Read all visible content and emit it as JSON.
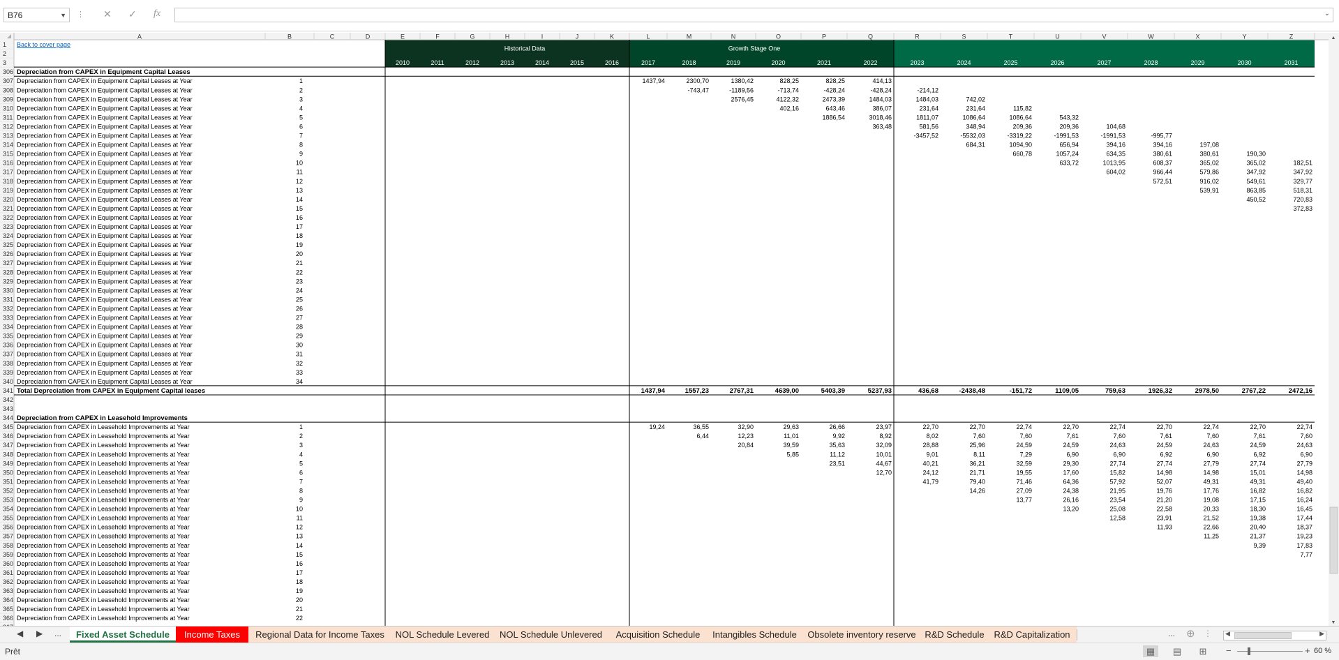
{
  "formula_bar": {
    "name_box": "B76",
    "formula": "",
    "cancel_icon": "✕",
    "enter_icon": "✓",
    "fx_icon": "fx"
  },
  "sheet": {
    "col_headers": [
      "A",
      "B",
      "C",
      "D",
      "E",
      "F",
      "G",
      "H",
      "I",
      "J",
      "K",
      "L",
      "M",
      "N",
      "O",
      "P",
      "Q",
      "R",
      "S",
      "T",
      "U",
      "V",
      "W",
      "X",
      "Y",
      "Z"
    ],
    "back_link": "Back to cover page",
    "group_labels": {
      "historical": "Historical Data",
      "growth": "Growth Stage One"
    },
    "years": [
      "2010",
      "2011",
      "2012",
      "2013",
      "2014",
      "2015",
      "2016",
      "2017",
      "2018",
      "2019",
      "2020",
      "2021",
      "2022",
      "2023",
      "2024",
      "2025",
      "2026",
      "2027",
      "2028",
      "2029",
      "2030",
      "2031"
    ],
    "sections": [
      {
        "header_row": 306,
        "title": "Depreciation from CAPEX in Equipment Capital Leases",
        "label": "Depreciation from CAPEX in Equipment Capital Leases at Year",
        "rows": [
          {
            "r": 307,
            "b": "1",
            "v": {
              "L": "1437,94",
              "M": "2300,70",
              "N": "1380,42",
              "O": "828,25",
              "P": "828,25",
              "Q": "414,13"
            }
          },
          {
            "r": 308,
            "b": "2",
            "v": {
              "M": "-743,47",
              "N": "-1189,56",
              "O": "-713,74",
              "P": "-428,24",
              "Q": "-428,24",
              "R": "-214,12"
            }
          },
          {
            "r": 309,
            "b": "3",
            "v": {
              "N": "2576,45",
              "O": "4122,32",
              "P": "2473,39",
              "Q": "1484,03",
              "R": "1484,03",
              "S": "742,02"
            }
          },
          {
            "r": 310,
            "b": "4",
            "v": {
              "O": "402,16",
              "P": "643,46",
              "Q": "386,07",
              "R": "231,64",
              "S": "231,64",
              "T": "115,82"
            }
          },
          {
            "r": 311,
            "b": "5",
            "v": {
              "P": "1886,54",
              "Q": "3018,46",
              "R": "1811,07",
              "S": "1086,64",
              "T": "1086,64",
              "U": "543,32"
            }
          },
          {
            "r": 312,
            "b": "6",
            "v": {
              "Q": "363,48",
              "R": "581,56",
              "S": "348,94",
              "T": "209,36",
              "U": "209,36",
              "V": "104,68"
            }
          },
          {
            "r": 313,
            "b": "7",
            "v": {
              "R": "-3457,52",
              "S": "-5532,03",
              "T": "-3319,22",
              "U": "-1991,53",
              "V": "-1991,53",
              "W": "-995,77"
            }
          },
          {
            "r": 314,
            "b": "8",
            "v": {
              "S": "684,31",
              "T": "1094,90",
              "U": "656,94",
              "V": "394,16",
              "W": "394,16",
              "X": "197,08"
            }
          },
          {
            "r": 315,
            "b": "9",
            "v": {
              "T": "660,78",
              "U": "1057,24",
              "V": "634,35",
              "W": "380,61",
              "X": "380,61",
              "Y": "190,30"
            }
          },
          {
            "r": 316,
            "b": "10",
            "v": {
              "U": "633,72",
              "V": "1013,95",
              "W": "608,37",
              "X": "365,02",
              "Y": "365,02",
              "Z": "182,51"
            }
          },
          {
            "r": 317,
            "b": "11",
            "v": {
              "V": "604,02",
              "W": "966,44",
              "X": "579,86",
              "Y": "347,92",
              "Z": "347,92"
            }
          },
          {
            "r": 318,
            "b": "12",
            "v": {
              "W": "572,51",
              "X": "916,02",
              "Y": "549,61",
              "Z": "329,77"
            }
          },
          {
            "r": 319,
            "b": "13",
            "v": {
              "X": "539,91",
              "Y": "863,85",
              "Z": "518,31"
            }
          },
          {
            "r": 320,
            "b": "14",
            "v": {
              "Y": "450,52",
              "Z": "720,83"
            }
          },
          {
            "r": 321,
            "b": "15",
            "v": {
              "Z": "372,83"
            }
          },
          {
            "r": 322,
            "b": "16",
            "v": {}
          },
          {
            "r": 323,
            "b": "17",
            "v": {}
          },
          {
            "r": 324,
            "b": "18",
            "v": {}
          },
          {
            "r": 325,
            "b": "19",
            "v": {}
          },
          {
            "r": 326,
            "b": "20",
            "v": {}
          },
          {
            "r": 327,
            "b": "21",
            "v": {}
          },
          {
            "r": 328,
            "b": "22",
            "v": {}
          },
          {
            "r": 329,
            "b": "23",
            "v": {}
          },
          {
            "r": 330,
            "b": "24",
            "v": {}
          },
          {
            "r": 331,
            "b": "25",
            "v": {}
          },
          {
            "r": 332,
            "b": "26",
            "v": {}
          },
          {
            "r": 333,
            "b": "27",
            "v": {}
          },
          {
            "r": 334,
            "b": "28",
            "v": {}
          },
          {
            "r": 335,
            "b": "29",
            "v": {}
          },
          {
            "r": 336,
            "b": "30",
            "v": {}
          },
          {
            "r": 337,
            "b": "31",
            "v": {}
          },
          {
            "r": 338,
            "b": "32",
            "v": {}
          },
          {
            "r": 339,
            "b": "33",
            "v": {}
          },
          {
            "r": 340,
            "b": "34",
            "v": {}
          }
        ],
        "total": {
          "r": 341,
          "label": "Total Depreciation from CAPEX in Equipment Capital leases",
          "v": {
            "L": "1437,94",
            "M": "1557,23",
            "N": "2767,31",
            "O": "4639,00",
            "P": "5403,39",
            "Q": "5237,93",
            "R": "436,68",
            "S": "-2438,48",
            "T": "-151,72",
            "U": "1109,05",
            "V": "759,63",
            "W": "1926,32",
            "X": "2978,50",
            "Y": "2767,22",
            "Z": "2472,16"
          }
        }
      },
      {
        "header_row": 344,
        "title": "Depreciation from CAPEX in Leasehold Improvements",
        "label": "Depreciation from CAPEX in Leasehold Improvements at Year",
        "rows": [
          {
            "r": 345,
            "b": "1",
            "v": {
              "L": "19,24",
              "M": "36,55",
              "N": "32,90",
              "O": "29,63",
              "P": "26,66",
              "Q": "23,97",
              "R": "22,70",
              "S": "22,70",
              "T": "22,74",
              "U": "22,70",
              "V": "22,74",
              "W": "22,70",
              "X": "22,74",
              "Y": "22,70",
              "Z": "22,74"
            }
          },
          {
            "r": 346,
            "b": "2",
            "v": {
              "M": "6,44",
              "N": "12,23",
              "O": "11,01",
              "P": "9,92",
              "Q": "8,92",
              "R": "8,02",
              "S": "7,60",
              "T": "7,60",
              "U": "7,61",
              "V": "7,60",
              "W": "7,61",
              "X": "7,60",
              "Y": "7,61",
              "Z": "7,60"
            }
          },
          {
            "r": 347,
            "b": "3",
            "v": {
              "N": "20,84",
              "O": "39,59",
              "P": "35,63",
              "Q": "32,09",
              "R": "28,88",
              "S": "25,96",
              "T": "24,59",
              "U": "24,59",
              "V": "24,63",
              "W": "24,59",
              "X": "24,63",
              "Y": "24,59",
              "Z": "24,63"
            }
          },
          {
            "r": 348,
            "b": "4",
            "v": {
              "O": "5,85",
              "P": "11,12",
              "Q": "10,01",
              "R": "9,01",
              "S": "8,11",
              "T": "7,29",
              "U": "6,90",
              "V": "6,90",
              "W": "6,92",
              "X": "6,90",
              "Y": "6,92",
              "Z": "6,90"
            }
          },
          {
            "r": 349,
            "b": "5",
            "v": {
              "P": "23,51",
              "Q": "44,67",
              "R": "40,21",
              "S": "36,21",
              "T": "32,59",
              "U": "29,30",
              "V": "27,74",
              "W": "27,74",
              "X": "27,79",
              "Y": "27,74",
              "Z": "27,79"
            }
          },
          {
            "r": 350,
            "b": "6",
            "v": {
              "Q": "12,70",
              "R": "24,12",
              "S": "21,71",
              "T": "19,55",
              "U": "17,60",
              "V": "15,82",
              "W": "14,98",
              "X": "14,98",
              "Y": "15,01",
              "Z": "14,98"
            }
          },
          {
            "r": 351,
            "b": "7",
            "v": {
              "R": "41,79",
              "S": "79,40",
              "T": "71,46",
              "U": "64,36",
              "V": "57,92",
              "W": "52,07",
              "X": "49,31",
              "Y": "49,31",
              "Z": "49,40"
            }
          },
          {
            "r": 352,
            "b": "8",
            "v": {
              "S": "14,26",
              "T": "27,09",
              "U": "24,38",
              "V": "21,95",
              "W": "19,76",
              "X": "17,76",
              "Y": "16,82",
              "Z": "16,82"
            }
          },
          {
            "r": 353,
            "b": "9",
            "v": {
              "T": "13,77",
              "U": "26,16",
              "V": "23,54",
              "W": "21,20",
              "X": "19,08",
              "Y": "17,15",
              "Z": "16,24"
            }
          },
          {
            "r": 354,
            "b": "10",
            "v": {
              "U": "13,20",
              "V": "25,08",
              "W": "22,58",
              "X": "20,33",
              "Y": "18,30",
              "Z": "16,45"
            }
          },
          {
            "r": 355,
            "b": "11",
            "v": {
              "V": "12,58",
              "W": "23,91",
              "X": "21,52",
              "Y": "19,38",
              "Z": "17,44"
            }
          },
          {
            "r": 356,
            "b": "12",
            "v": {
              "W": "11,93",
              "X": "22,66",
              "Y": "20,40",
              "Z": "18,37"
            }
          },
          {
            "r": 357,
            "b": "13",
            "v": {
              "X": "11,25",
              "Y": "21,37",
              "Z": "19,23"
            }
          },
          {
            "r": 358,
            "b": "14",
            "v": {
              "Y": "9,39",
              "Z": "17,83"
            }
          },
          {
            "r": 359,
            "b": "15",
            "v": {
              "Z": "7,77"
            }
          },
          {
            "r": 360,
            "b": "16",
            "v": {}
          },
          {
            "r": 361,
            "b": "17",
            "v": {}
          },
          {
            "r": 362,
            "b": "18",
            "v": {}
          },
          {
            "r": 363,
            "b": "19",
            "v": {}
          },
          {
            "r": 364,
            "b": "20",
            "v": {}
          },
          {
            "r": 365,
            "b": "21",
            "v": {}
          },
          {
            "r": 366,
            "b": "22",
            "v": {}
          }
        ]
      }
    ]
  },
  "tabs": {
    "items": [
      {
        "label": "Fixed Asset Schedule",
        "state": "active"
      },
      {
        "label": "Income Taxes",
        "state": "red"
      },
      {
        "label": "Regional Data for Income Taxes",
        "state": "normal"
      },
      {
        "label": "NOL Schedule Levered",
        "state": "normal"
      },
      {
        "label": "NOL Schedule Unlevered",
        "state": "normal"
      },
      {
        "label": "Acquisition Schedule",
        "state": "normal"
      },
      {
        "label": "Intangibles Schedule",
        "state": "normal"
      },
      {
        "label": "Obsolete inventory reserve",
        "state": "normal"
      },
      {
        "label": "R&D Schedule",
        "state": "normal"
      },
      {
        "label": "R&D Capitalization",
        "state": "normal"
      }
    ],
    "more": "...",
    "nav_prev": "◀",
    "nav_next": "▶",
    "add_icon": "⊕"
  },
  "status": {
    "ready": "Prêt",
    "zoom": "60 %"
  },
  "colors": {
    "historical_header": "#0b3320",
    "growth_header": "#00452a",
    "growth2_header": "#006a46",
    "link": "#0563c1",
    "tab_bg": "#fbe1cf",
    "active_tab": "#217346",
    "red_tab": "#ff0000"
  }
}
